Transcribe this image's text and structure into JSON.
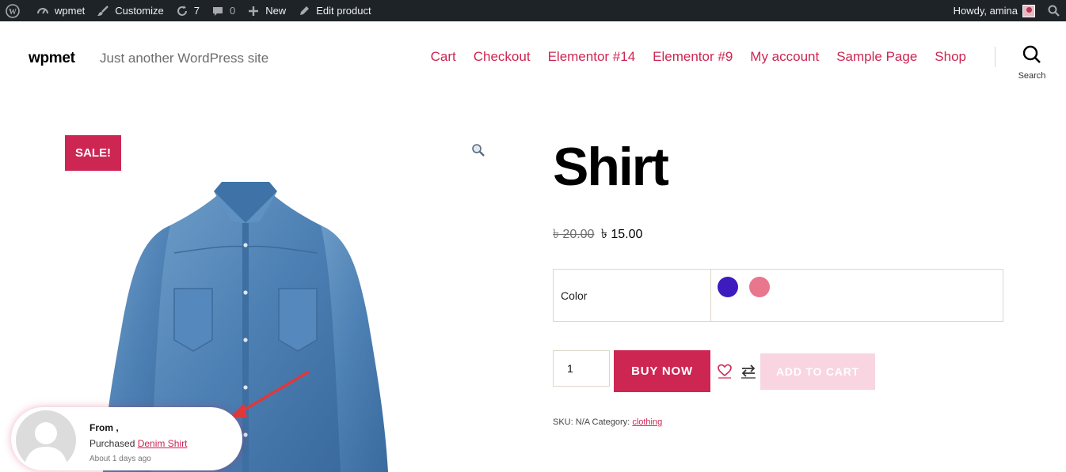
{
  "adminbar": {
    "site": "wpmet",
    "customize": "Customize",
    "updates": "7",
    "comments": "0",
    "new": "New",
    "edit": "Edit product",
    "howdy": "Howdy, amina"
  },
  "header": {
    "logo": "wpmet",
    "tagline": "Just another WordPress site",
    "nav": [
      "Cart",
      "Checkout",
      "Elementor #14",
      "Elementor #9",
      "My account",
      "Sample Page",
      "Shop"
    ],
    "search_label": "Search"
  },
  "product": {
    "sale_badge": "SALE!",
    "title": "Shirt",
    "price_old": "৳ 20.00",
    "price_new": "৳ 15.00",
    "variation_label": "Color",
    "swatches": [
      "#3d1bbf",
      "#e8768c"
    ],
    "quantity": "1",
    "buy_now": "BUY NOW",
    "add_to_cart": "ADD TO CART",
    "sku_label": "SKU:",
    "sku_value": "N/A",
    "category_label": "Category:",
    "category_value": "clothing"
  },
  "popup": {
    "from": "From ,",
    "purchased": "Purchased",
    "product_link": "Denim Shirt",
    "time": "About 1 days ago"
  },
  "colors": {
    "accent": "#cd2653",
    "adminbar": "#1d2327"
  }
}
